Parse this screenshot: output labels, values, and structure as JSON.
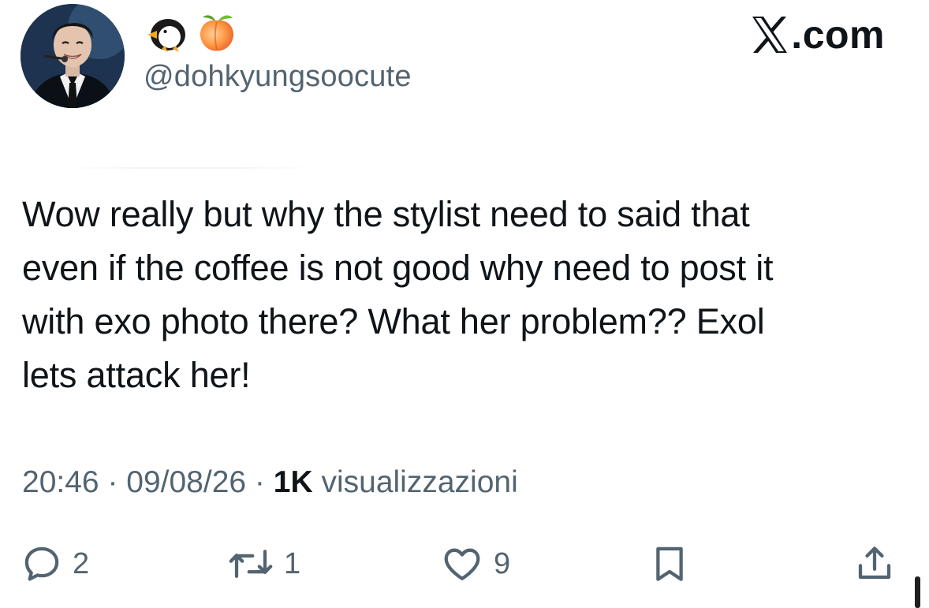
{
  "header": {
    "display_name_emojis": [
      "penguin-emoji",
      "peach-emoji"
    ],
    "handle": "@dohkyungsoocute",
    "brand_text": ".com"
  },
  "tweet": {
    "lines": [
      "Wow really but why the stylist need to said that",
      "even if the coffee is not good why need to post it",
      "with exo photo there? What her problem?? Exol",
      "lets attack her!"
    ]
  },
  "meta": {
    "time": "20:46",
    "separator": " · ",
    "date": "09/08/26",
    "views_count": "1K",
    "views_label": " visualizzazioni"
  },
  "actions": {
    "reply_count": "2",
    "retweet_count": "1",
    "like_count": "9"
  },
  "colors": {
    "text": "#0f1419",
    "secondary": "#536471",
    "background": "#ffffff"
  }
}
